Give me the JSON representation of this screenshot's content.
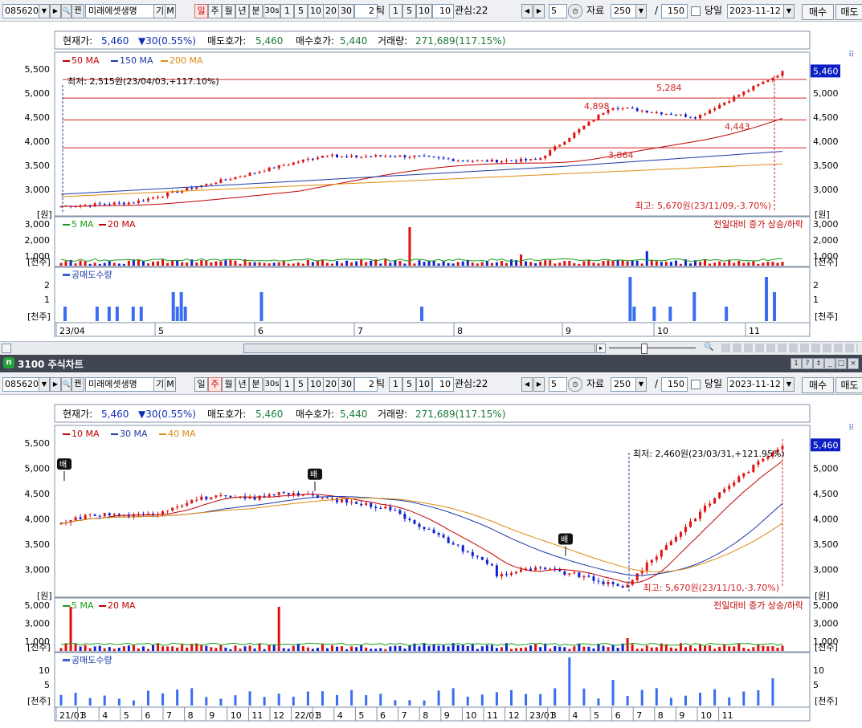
{
  "toolbar": {
    "code": "085620",
    "name": "미래에셋생명",
    "name_btn1": "기",
    "name_btn2": "M",
    "period_tabs": [
      "일",
      "주",
      "월",
      "년",
      "분"
    ],
    "interval_btns": [
      "30s",
      "1",
      "5",
      "10",
      "20",
      "30"
    ],
    "tick_value": "2",
    "tick_label": "틱",
    "tick_btns": [
      "1",
      "5",
      "10"
    ],
    "custom_value": "10",
    "watch_label": "관심:22",
    "count_value": "5",
    "data_label": "자료",
    "data_value": "250",
    "slash": "/",
    "total_value": "150",
    "today_label": "당일",
    "date_value": "2023-11-12",
    "buy_label": "매수",
    "sell_label": "매도"
  },
  "window_title": "3100 주식차트",
  "charts": [
    {
      "selected_period": "일",
      "info": {
        "cur_label": "현재가:",
        "cur_value": "5,460",
        "change": "▼30(0.55%)",
        "ask_label": "매도호가:",
        "ask_value": "5,460",
        "bid_label": "매수호가:",
        "bid_value": "5,440",
        "vol_label": "거래량:",
        "vol_value": "271,689(117.15%)"
      },
      "ma_legend": [
        {
          "label": "50 MA",
          "color": "#c00000"
        },
        {
          "label": "150 MA",
          "color": "#1a3aa8"
        },
        {
          "label": "200 MA",
          "color": "#e08a10"
        }
      ],
      "low_note": "최저: 2,515원(23/04/03,+117.10%)",
      "high_note": "최고: 5,670원(23/11/09,-3.70%)",
      "level_labels": [
        "5,284",
        "4,898",
        "4,443",
        "3,864"
      ],
      "current_price_tag": "5,460",
      "price_axis": [
        "5,500",
        "5,000",
        "4,500",
        "4,000",
        "3,500",
        "3,000"
      ],
      "price_unit": "[원]",
      "vol_legend": [
        {
          "label": "5 MA",
          "color": "#16a016"
        },
        {
          "label": "20 MA",
          "color": "#c00000"
        }
      ],
      "vol_note": "전일대비 증가 상승/하락",
      "vol_axis": [
        "3,000",
        "2,000",
        "1,000"
      ],
      "vol_unit": "[천주]",
      "short_label": "공매도수량",
      "short_axis": [
        "2",
        "1"
      ],
      "short_unit": "[천주]",
      "x_labels": [
        "23/04",
        "5",
        "6",
        "7",
        "8",
        "9",
        "10",
        "11"
      ]
    },
    {
      "selected_period": "주",
      "info": {
        "cur_label": "현재가:",
        "cur_value": "5,460",
        "change": "▼30(0.55%)",
        "ask_label": "매도호가:",
        "ask_value": "5,460",
        "bid_label": "매수호가:",
        "bid_value": "5,440",
        "vol_label": "거래량:",
        "vol_value": "271,689(117.15%)"
      },
      "ma_legend": [
        {
          "label": "10 MA",
          "color": "#c00000"
        },
        {
          "label": "30 MA",
          "color": "#1a3aa8"
        },
        {
          "label": "40 MA",
          "color": "#e08a10"
        }
      ],
      "low_note": "최저: 2,460원(23/03/31,+121.95%)",
      "high_note": "최고: 5,670원(23/11/10,-3.70%)",
      "marker_label": "배",
      "current_price_tag": "5,460",
      "price_axis": [
        "5,500",
        "5,000",
        "4,500",
        "4,000",
        "3,500",
        "3,000"
      ],
      "price_unit": "[원]",
      "vol_legend": [
        {
          "label": "5 MA",
          "color": "#16a016"
        },
        {
          "label": "20 MA",
          "color": "#c00000"
        }
      ],
      "vol_note": "전일대비 증가 상승/하락",
      "vol_axis": [
        "5,000",
        "3,000",
        "1,000"
      ],
      "vol_unit": "[천주]",
      "short_label": "공매도수량",
      "short_axis": [
        "10",
        "5"
      ],
      "short_unit": "[천주]",
      "x_labels": [
        "21/01",
        "3",
        "4",
        "5",
        "6",
        "7",
        "8",
        "9",
        "10",
        "11",
        "12",
        "22/01",
        "3",
        "4",
        "5",
        "6",
        "7",
        "8",
        "9",
        "10",
        "11",
        "12",
        "23/01",
        "3",
        "4",
        "5",
        "6",
        "7",
        "8",
        "9",
        "10",
        "11"
      ]
    }
  ],
  "colors": {
    "up": "#e01010",
    "down": "#1020d0",
    "grid_level": "#d02020",
    "panel_border": "#8090a8"
  }
}
